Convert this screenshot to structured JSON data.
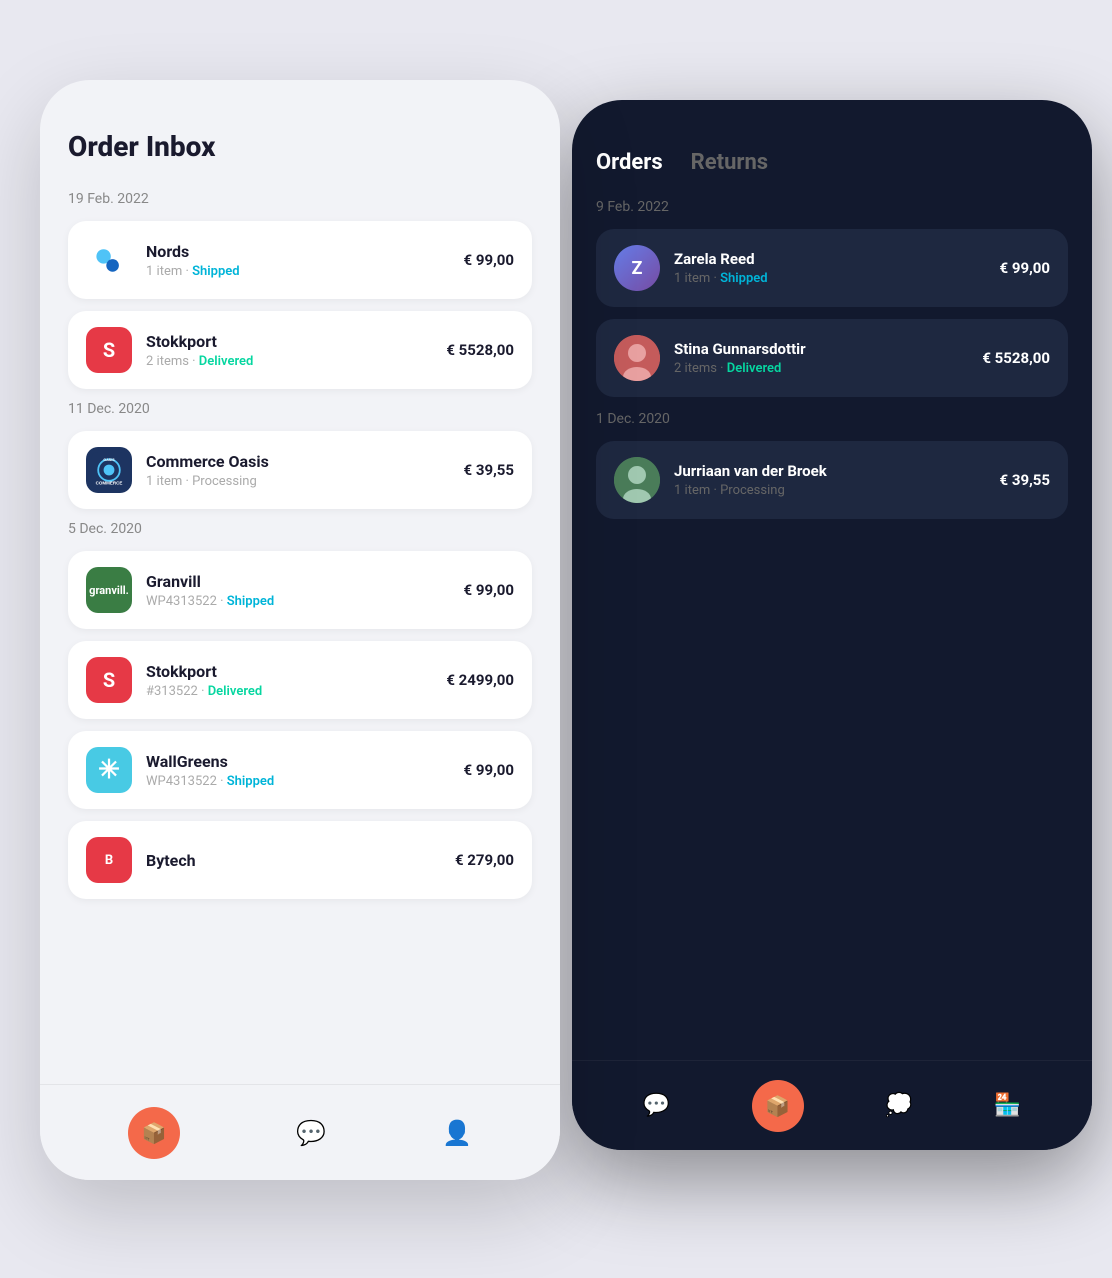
{
  "light_phone": {
    "title": "Order Inbox",
    "sections": [
      {
        "date": "19 Feb. 2022",
        "orders": [
          {
            "id": "nords",
            "name": "Nords",
            "sub": "1 item",
            "status": "Shipped",
            "status_type": "shipped",
            "amount": "€ 99,00",
            "logo_type": "nords"
          },
          {
            "id": "stokkport-1",
            "name": "Stokkport",
            "sub": "2 items",
            "status": "Delivered",
            "status_type": "delivered",
            "amount": "€ 5528,00",
            "logo_type": "stokkport"
          }
        ]
      },
      {
        "date": "11 Dec. 2020",
        "orders": [
          {
            "id": "commerce-oasis",
            "name": "Commerce Oasis",
            "sub": "1 item",
            "status": "Processing",
            "status_type": "processing",
            "amount": "€ 39,55",
            "logo_type": "commerce"
          }
        ]
      },
      {
        "date": "5 Dec. 2020",
        "orders": [
          {
            "id": "granvill",
            "name": "Granvill",
            "sub": "WP4313522",
            "status": "Shipped",
            "status_type": "shipped",
            "amount": "€ 99,00",
            "logo_type": "granvill"
          },
          {
            "id": "stokkport-2",
            "name": "Stokkport",
            "sub": "#313522",
            "status": "Delivered",
            "status_type": "delivered",
            "amount": "€ 2499,00",
            "logo_type": "stokkport"
          },
          {
            "id": "wallgreens",
            "name": "WallGreens",
            "sub": "WP4313522",
            "status": "Shipped",
            "status_type": "shipped",
            "amount": "€ 99,00",
            "logo_type": "wallgreens"
          },
          {
            "id": "bytech",
            "name": "Bytech",
            "sub": "",
            "status": "",
            "status_type": "",
            "amount": "€ 279,00",
            "logo_type": "bytech"
          }
        ]
      }
    ],
    "nav": {
      "inbox_label": "inbox",
      "chat_label": "chat",
      "profile_label": "profile"
    }
  },
  "dark_phone": {
    "tabs": [
      {
        "label": "Orders",
        "active": true
      },
      {
        "label": "Returns",
        "active": false
      }
    ],
    "sections": [
      {
        "date": "9 Feb. 2022",
        "orders": [
          {
            "id": "zarela",
            "name": "Zarela Reed",
            "sub": "1 item",
            "status": "Shipped",
            "status_type": "shipped",
            "amount": "€ 99,00",
            "avatar_type": "zarela"
          },
          {
            "id": "stina",
            "name": "Stina Gunnarsdottir",
            "sub": "2 items",
            "status": "Delivered",
            "status_type": "delivered",
            "amount": "€ 5528,00",
            "avatar_type": "stina"
          }
        ]
      },
      {
        "date": "1 Dec. 2020",
        "orders": [
          {
            "id": "jurriaan",
            "name": "Jurriaan van der Broek",
            "sub": "1 item",
            "status": "Processing",
            "status_type": "processing",
            "amount": "€ 39,55",
            "avatar_type": "jurriaan"
          }
        ]
      }
    ],
    "nav": {
      "chat_label": "chat",
      "inbox_label": "inbox",
      "message_label": "message",
      "store_label": "store"
    }
  },
  "status_labels": {
    "shipped": "Shipped",
    "delivered": "Delivered",
    "processing": "Processing"
  }
}
